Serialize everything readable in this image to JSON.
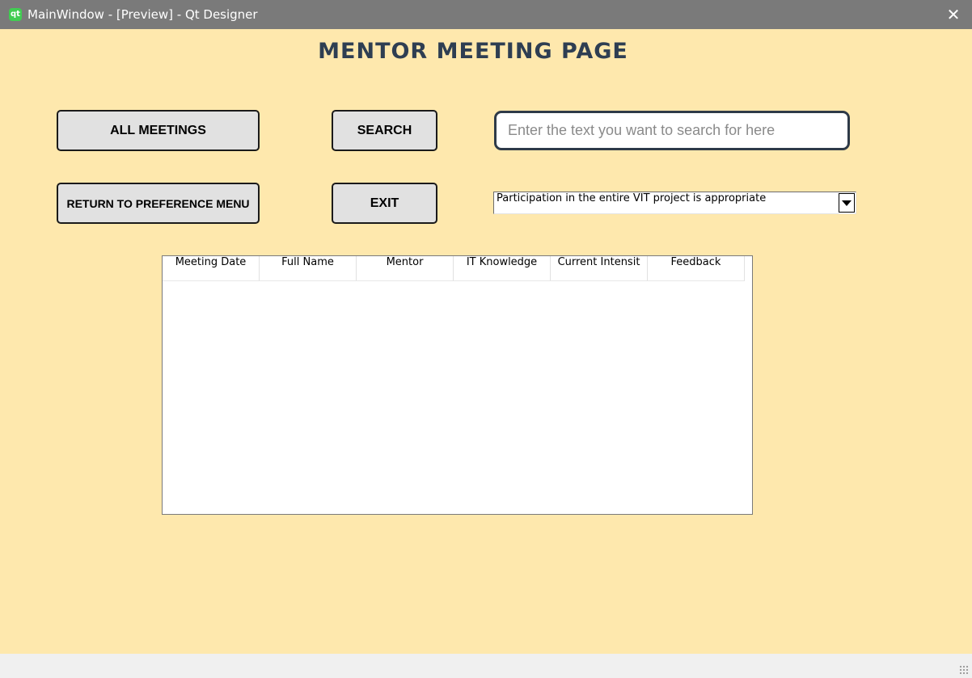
{
  "window": {
    "title": "MainWindow - [Preview] - Qt Designer",
    "app_icon_glyph": "qt",
    "close_glyph": "✕"
  },
  "page": {
    "title": "MENTOR MEETING PAGE"
  },
  "buttons": {
    "all_meetings": "ALL MEETINGS",
    "search": "SEARCH",
    "return_menu": "RETURN TO PREFERENCE MENU",
    "exit": "EXIT"
  },
  "search": {
    "placeholder": "Enter the text you want to search for here",
    "value": ""
  },
  "combo": {
    "selected": "Participation in the entire VIT project is appropriate"
  },
  "table": {
    "columns": [
      "Meeting Date",
      "Full Name",
      "Mentor",
      "IT Knowledge",
      "Current Intensit",
      "Feedback"
    ],
    "rows": []
  },
  "colors": {
    "background": "#fee8ad",
    "titlebar": "#7a7a7a",
    "title_text": "#2e3e52",
    "button": "#e1e1e1"
  },
  "icons": {
    "app": "qt-designer-icon",
    "close": "close-icon",
    "dropdown": "chevron-down-icon",
    "grip": "size-grip-icon"
  }
}
